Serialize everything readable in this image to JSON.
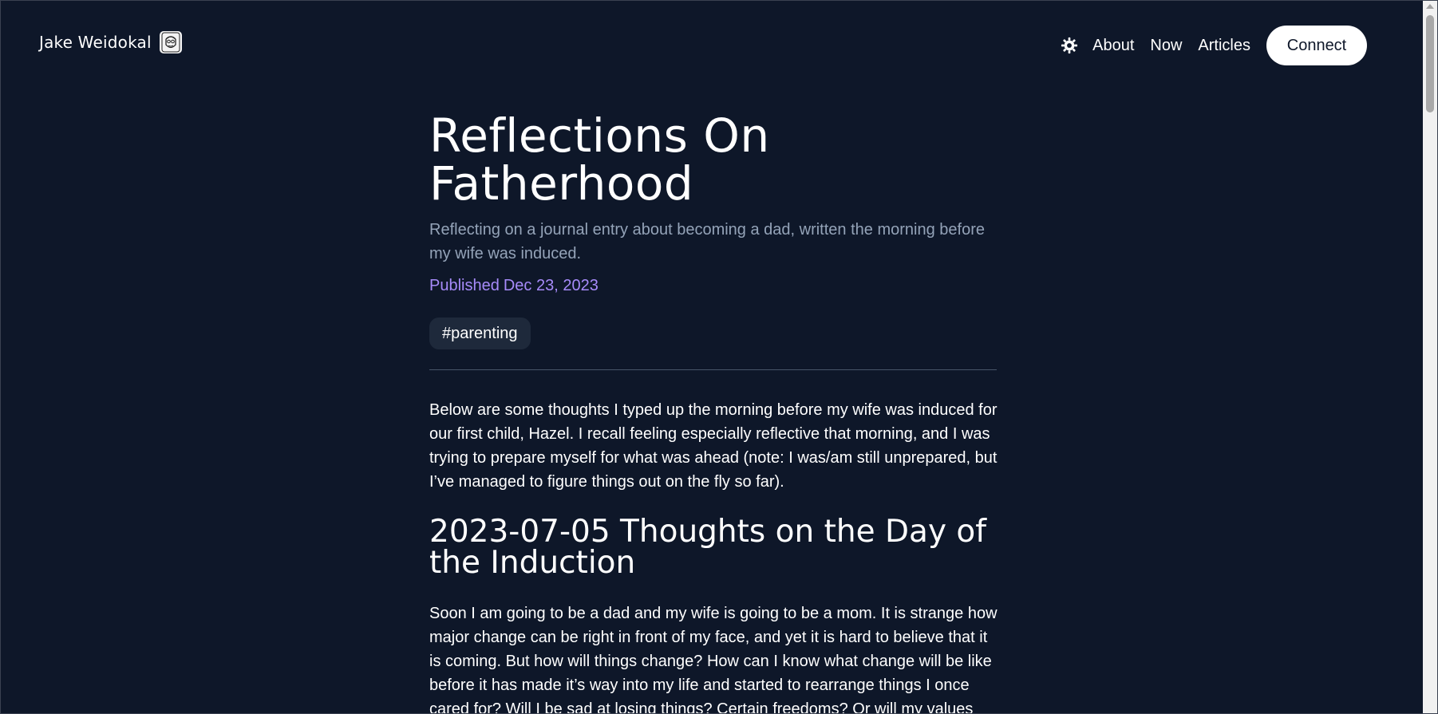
{
  "header": {
    "brand_name": "Jake Weidokal",
    "nav": {
      "about": "About",
      "now": "Now",
      "articles": "Articles",
      "connect": "Connect"
    }
  },
  "article": {
    "title": "Reflections On Fatherhood",
    "subtitle": "Reflecting on a journal entry about becoming a dad, written the morning before my wife was induced.",
    "published_label": "Published",
    "published_date": "Dec 23, 2023",
    "tag": "#parenting",
    "intro": "Below are some thoughts I typed up the morning before my wife was induced for our first child, Hazel. I recall feeling especially reflective that morning, and I was trying to prepare myself for what was ahead (note: I was/am still unprepared, but I’ve managed to figure things out on the fly so far).",
    "section_heading": "2023-07-05 Thoughts on the Day of the Induction",
    "body": "Soon I am going to be a dad and my wife is going to be a mom. It is strange how major change can be right in front of my face, and yet it is hard to believe that it is coming. But how will things change? How can I know what change will be like before it has made it’s way into my life and started to rearrange things I once cared for? Will I be sad at losing things? Certain freedoms? Or will my values"
  },
  "colors": {
    "background": "#0e1729",
    "subtitle": "#94a3b8",
    "published": "#a78bfa",
    "tag_bg": "#1e293b"
  },
  "icons": {
    "theme_toggle": "sun-gear-icon",
    "avatar": "avatar-sketch-icon"
  }
}
